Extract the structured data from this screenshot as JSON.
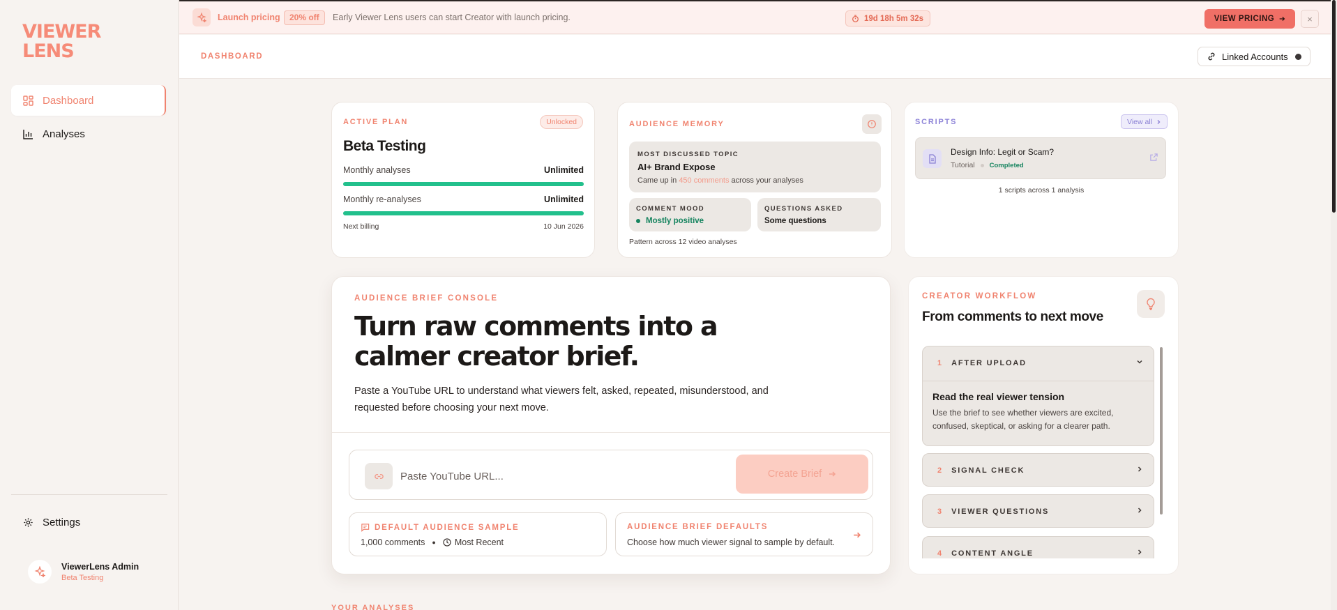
{
  "brand": {
    "line1": "VIEWER",
    "line2": "LENS"
  },
  "sidebar": {
    "items": [
      {
        "label": "Dashboard",
        "icon": "dashboard-icon",
        "active": true
      },
      {
        "label": "Analyses",
        "icon": "bar-chart-icon",
        "active": false
      }
    ],
    "settings_label": "Settings",
    "user": {
      "name": "ViewerLens Admin",
      "plan": "Beta Testing"
    }
  },
  "banner": {
    "title": "Launch pricing",
    "discount": "20% off",
    "text": "Early Viewer Lens users can start Creator with launch pricing.",
    "timer": "19d 18h 5m 32s",
    "cta": "VIEW PRICING",
    "close": "×"
  },
  "header": {
    "title": "DASHBOARD",
    "linked_accounts": "Linked Accounts"
  },
  "plan": {
    "eyebrow": "ACTIVE PLAN",
    "badge": "Unlocked",
    "name": "Beta Testing",
    "rows": [
      {
        "label": "Monthly analyses",
        "value": "Unlimited",
        "fill": 1.0
      },
      {
        "label": "Monthly re-analyses",
        "value": "Unlimited",
        "fill": 1.0
      }
    ],
    "next_billing_label": "Next billing",
    "next_billing_date": "10 Jun 2026"
  },
  "memory": {
    "eyebrow": "AUDIENCE MEMORY",
    "topic_label": "MOST DISCUSSED TOPIC",
    "topic": "AI+ Brand Expose",
    "topic_sub_pre": "Came up in ",
    "topic_sub_hl": "450 comments",
    "topic_sub_post": " across your analyses",
    "mood_label": "COMMENT MOOD",
    "mood": "Mostly positive",
    "questions_label": "QUESTIONS ASKED",
    "questions": "Some questions",
    "footer": "Pattern across 12 video analyses"
  },
  "scripts": {
    "eyebrow": "SCRIPTS",
    "view_all": "View all",
    "item": {
      "title": "Design Info: Legit or Scam?",
      "type": "Tutorial",
      "status": "Completed"
    },
    "count": "1 scripts across 1 analysis"
  },
  "console": {
    "eyebrow": "AUDIENCE BRIEF CONSOLE",
    "headline": "Turn raw comments into a calmer creator brief.",
    "description": "Paste a YouTube URL to understand what viewers felt, asked, repeated, misunderstood, and requested before choosing your next move.",
    "url_placeholder": "Paste YouTube URL...",
    "create_label": "Create Brief",
    "sample_title": "DEFAULT AUDIENCE SAMPLE",
    "sample_count": "1,000 comments",
    "sample_order": "Most Recent",
    "defaults_title": "AUDIENCE BRIEF DEFAULTS",
    "defaults_text": "Choose how much viewer signal to sample by default."
  },
  "workflow": {
    "eyebrow": "CREATOR WORKFLOW",
    "title": "From comments to next move",
    "steps": [
      {
        "num": "1",
        "label": "AFTER UPLOAD",
        "open_title": "Read the real viewer tension",
        "open_text": "Use the brief to see whether viewers are excited, confused, skeptical, or asking for a clearer path."
      },
      {
        "num": "2",
        "label": "SIGNAL CHECK"
      },
      {
        "num": "3",
        "label": "VIEWER QUESTIONS"
      },
      {
        "num": "4",
        "label": "CONTENT ANGLE"
      }
    ]
  },
  "your_analyses": "YOUR ANALYSES",
  "colors": {
    "accent": "#f0836f",
    "success": "#22c08c",
    "scripts_accent": "#8e84d8"
  }
}
